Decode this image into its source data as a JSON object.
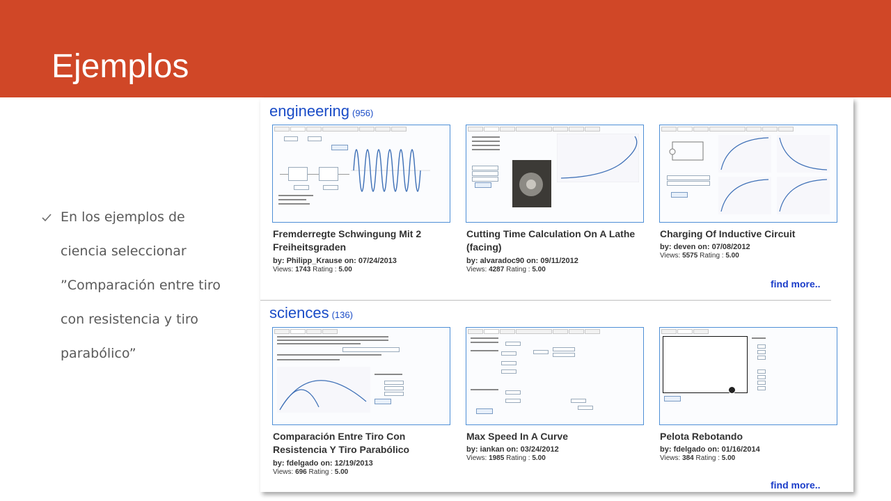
{
  "slide": {
    "title": "Ejemplos",
    "bullet": "En los ejemplos de ciencia seleccionar ”Comparación entre tiro con resistencia y tiro parabólico”",
    "accent_color": "#d04727"
  },
  "engineering": {
    "title": "engineering",
    "count": "(956)",
    "cards": [
      {
        "title": "Fremderregte Schwingung Mit 2 Freiheitsgraden",
        "by_label": "by:",
        "author": "Philipp_Krause",
        "on_label": "on:",
        "date": "07/24/2013",
        "views_label": "Views:",
        "views": "1743",
        "rating_label": "Rating :",
        "rating": "5.00"
      },
      {
        "title": "Cutting Time Calculation On A Lathe (facing)",
        "by_label": "by:",
        "author": "alvaradoc90",
        "on_label": "on:",
        "date": "09/11/2012",
        "views_label": "Views:",
        "views": "4287",
        "rating_label": "Rating :",
        "rating": "5.00"
      },
      {
        "title": "Charging Of Inductive Circuit",
        "by_label": "by:",
        "author": "deven",
        "on_label": "on:",
        "date": "07/08/2012",
        "views_label": "Views:",
        "views": "5575",
        "rating_label": "Rating :",
        "rating": "5.00"
      }
    ],
    "find_more": "find more.."
  },
  "sciences": {
    "title": "sciences",
    "count": "(136)",
    "cards": [
      {
        "title": "Comparación Entre Tiro Con Resistencia Y Tiro Parabólico",
        "by_label": "by:",
        "author": "fdelgado",
        "on_label": "on:",
        "date": "12/19/2013",
        "views_label": "Views:",
        "views": "696",
        "rating_label": "Rating :",
        "rating": "5.00"
      },
      {
        "title": "Max Speed In A Curve",
        "by_label": "by:",
        "author": "iankan",
        "on_label": "on:",
        "date": "03/24/2012",
        "views_label": "Views:",
        "views": "1985",
        "rating_label": "Rating :",
        "rating": "5.00"
      },
      {
        "title": "Pelota Rebotando",
        "by_label": "by:",
        "author": "fdelgado",
        "on_label": "on:",
        "date": "01/16/2014",
        "views_label": "Views:",
        "views": "384",
        "rating_label": "Rating :",
        "rating": "5.00"
      }
    ],
    "find_more": "find more.."
  },
  "colors": {
    "link": "#1a4cc7",
    "thumb_border": "#4e8fd6",
    "text": "#333333"
  }
}
